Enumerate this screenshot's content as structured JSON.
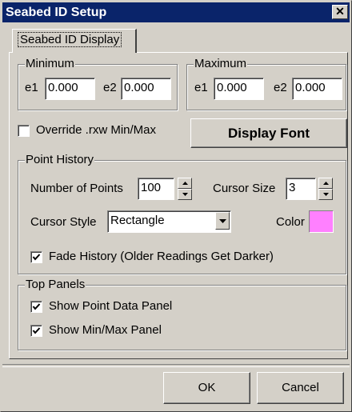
{
  "window": {
    "title": "Seabed ID Setup",
    "close_glyph": "✕"
  },
  "tabs": [
    {
      "label": "Seabed ID Display",
      "active": true
    }
  ],
  "minimum": {
    "legend": "Minimum",
    "e1_label": "e1",
    "e1_value": "0.000",
    "e2_label": "e2",
    "e2_value": "0.000"
  },
  "maximum": {
    "legend": "Maximum",
    "e1_label": "e1",
    "e1_value": "0.000",
    "e2_label": "e2",
    "e2_value": "0.000"
  },
  "override": {
    "label": "Override .rxw Min/Max",
    "checked": false
  },
  "display_font_button": "Display Font",
  "point_history": {
    "legend": "Point History",
    "num_points_label": "Number of Points",
    "num_points_value": "100",
    "cursor_size_label": "Cursor Size",
    "cursor_size_value": "3",
    "cursor_style_label": "Cursor Style",
    "cursor_style_value": "Rectangle",
    "color_label": "Color",
    "color_value": "#ff80ff",
    "fade_label": "Fade History (Older Readings Get Darker)",
    "fade_checked": true
  },
  "top_panels": {
    "legend": "Top Panels",
    "show_point_data_label": "Show Point Data Panel",
    "show_point_data_checked": true,
    "show_minmax_label": "Show Min/Max Panel",
    "show_minmax_checked": true
  },
  "buttons": {
    "ok": "OK",
    "cancel": "Cancel"
  },
  "icons": {
    "close": "close-icon",
    "check": "checkmark-icon",
    "spin_up": "spin-up-arrow-icon",
    "spin_down": "spin-down-arrow-icon",
    "dropdown": "dropdown-arrow-icon"
  }
}
